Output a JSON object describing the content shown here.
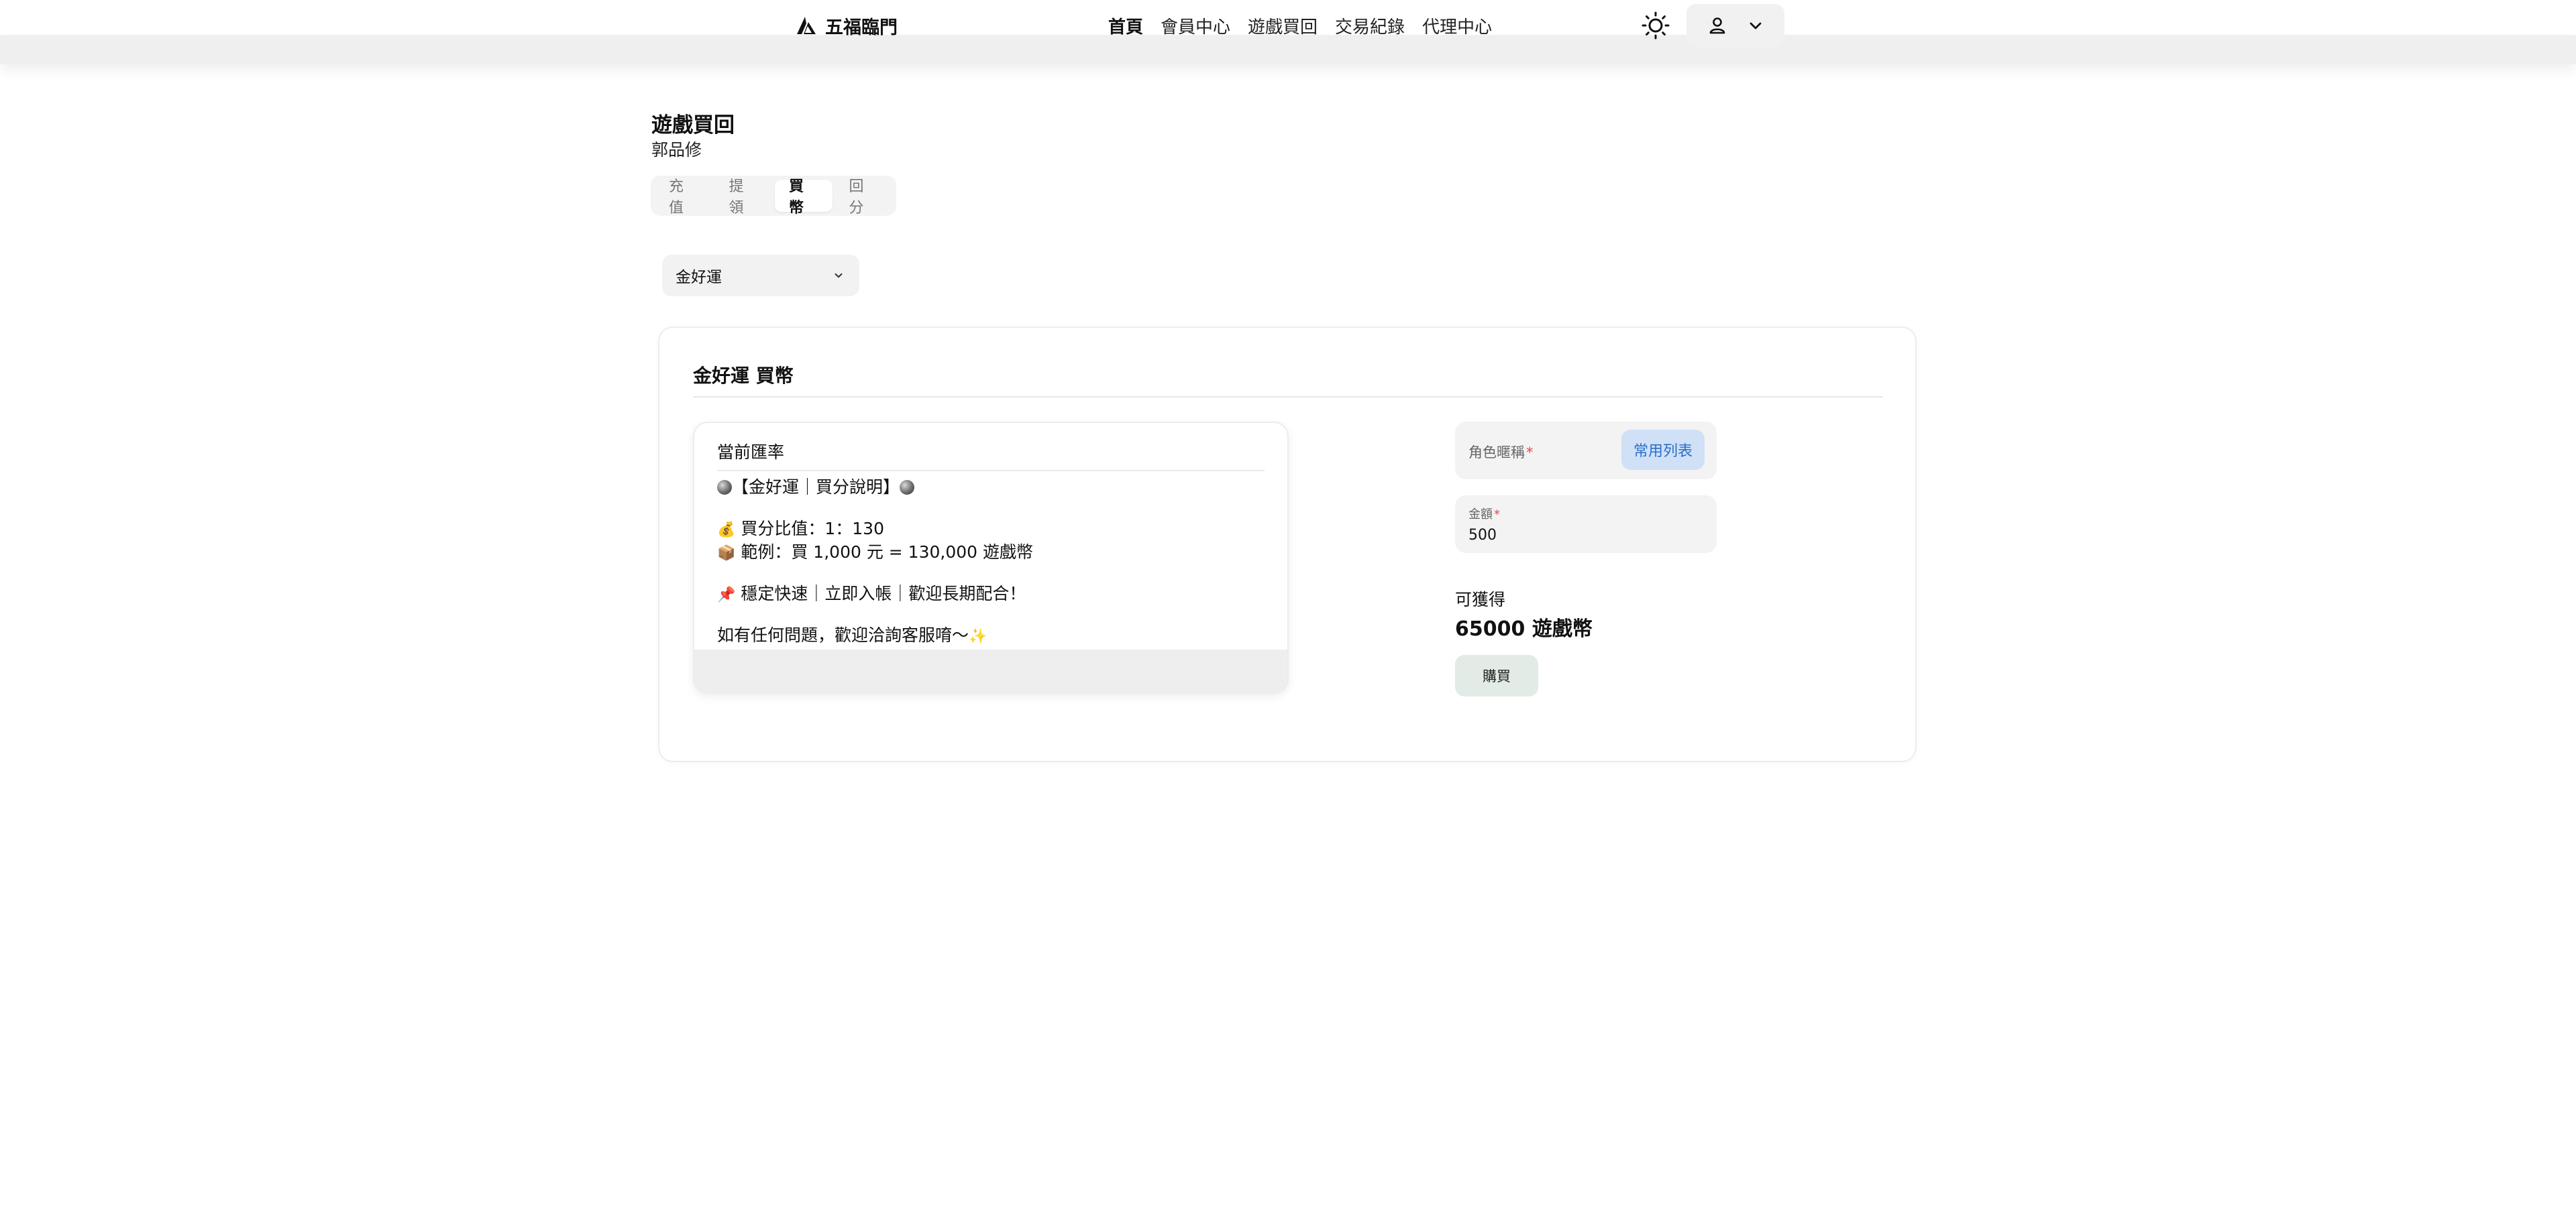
{
  "header": {
    "brand": "五福臨門",
    "nav": [
      {
        "label": "首頁",
        "active": true
      },
      {
        "label": "會員中心",
        "active": false
      },
      {
        "label": "遊戲買回",
        "active": false
      },
      {
        "label": "交易紀錄",
        "active": false
      },
      {
        "label": "代理中心",
        "active": false
      }
    ],
    "icons": {
      "theme": "sun-icon",
      "user": "user-icon",
      "menu": "chevron-down-icon"
    }
  },
  "page": {
    "title": "遊戲買回",
    "username": "郭品修",
    "tabs": [
      {
        "label": "充值",
        "active": false
      },
      {
        "label": "提領",
        "active": false
      },
      {
        "label": "買幣",
        "active": true
      },
      {
        "label": "回分",
        "active": false
      }
    ]
  },
  "game_select": {
    "value": "金好運"
  },
  "card": {
    "title": "金好運 買幣",
    "rate": {
      "header": "當前匯率",
      "lines": [
        "【金好運｜買分說明】",
        "",
        "買分比值：1：130",
        "範例：買 1,000 元 = 130,000 遊戲幣",
        "",
        "穩定快速｜立即入帳｜歡迎長期配合！",
        "",
        "如有任何問題，歡迎洽詢客服唷～"
      ]
    },
    "form": {
      "role_label": "角色暱稱",
      "role_value": "",
      "common_list_label": "常用列表",
      "amount_label": "金額",
      "amount_value": "500",
      "required_mark": "*",
      "obtain_label": "可獲得",
      "obtain_value": "65000 遊戲幣",
      "buy_label": "購買"
    }
  },
  "colors": {
    "accent_blue": "#2a6fc7",
    "accent_blue_bg": "#cfe0f7",
    "buy_bg": "#e2ebe6",
    "required": "#e5484d"
  }
}
